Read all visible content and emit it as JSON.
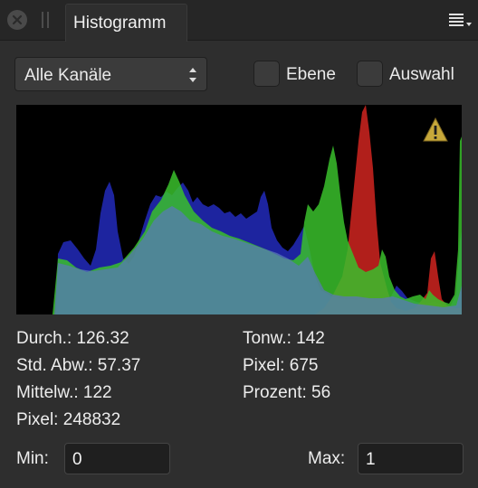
{
  "panel": {
    "tab_title": "Histogramm"
  },
  "controls": {
    "channel_select": "Alle Kanäle",
    "layer_checkbox": {
      "label": "Ebene",
      "checked": false
    },
    "selection_checkbox": {
      "label": "Auswahl",
      "checked": false
    }
  },
  "histogram": {
    "warning_icon": "warning-triangle-icon",
    "channel_colors": {
      "red": "#c4221e",
      "green": "#3ac02b",
      "blue": "#1f26a8",
      "luminosity": "#5a78b8"
    }
  },
  "stats": {
    "left": [
      {
        "label": "Durch.:",
        "value": "126.32"
      },
      {
        "label": "Std. Abw.:",
        "value": "57.37"
      },
      {
        "label": "Mittelw.:",
        "value": "122"
      },
      {
        "label": "Pixel:",
        "value": "248832"
      }
    ],
    "right": [
      {
        "label": "Tonw.:",
        "value": "142"
      },
      {
        "label": "Pixel:",
        "value": "675"
      },
      {
        "label": "Prozent:",
        "value": "56"
      }
    ]
  },
  "range": {
    "min_label": "Min:",
    "min_value": "0",
    "max_label": "Max:",
    "max_value": "1"
  }
}
